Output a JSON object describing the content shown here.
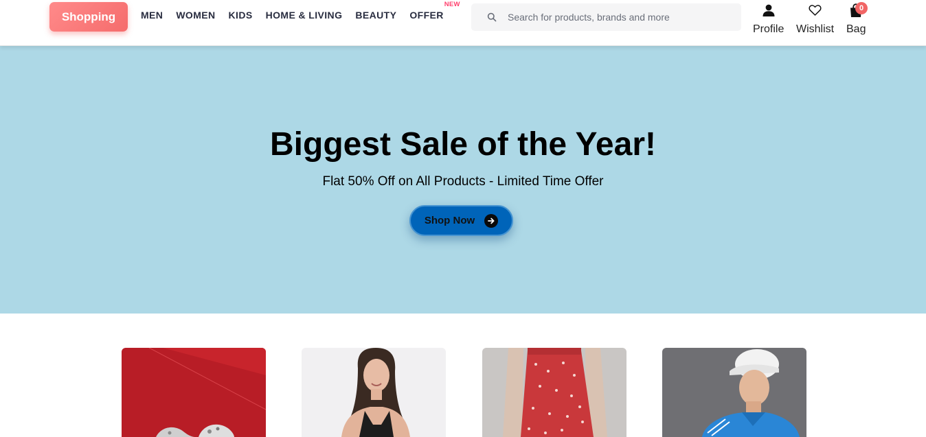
{
  "header": {
    "logo_label": "Shopping",
    "nav": [
      {
        "label": "MEN"
      },
      {
        "label": "WOMEN"
      },
      {
        "label": "KIDS"
      },
      {
        "label": "HOME & LIVING"
      },
      {
        "label": "BEAUTY"
      },
      {
        "label": "OFFER",
        "tag": "NEW"
      }
    ],
    "search": {
      "placeholder": "Search for products, brands and more",
      "value": ""
    },
    "actions": {
      "profile_label": "Profile",
      "wishlist_label": "Wishlist",
      "bag_label": "Bag",
      "bag_count": "0"
    }
  },
  "hero": {
    "title": "Biggest Sale of the Year!",
    "subtitle": "Flat 50% Off on All Products - Limited Time Offer",
    "cta_label": "Shop Now",
    "background_color": "#add8e6"
  },
  "products": [
    {
      "name": "product-card-jewelry"
    },
    {
      "name": "product-card-womens-top"
    },
    {
      "name": "product-card-floral-skirt"
    },
    {
      "name": "product-card-mens-polo"
    }
  ],
  "colors": {
    "logo": "#f56c6c",
    "nav_text": "#282c3f",
    "new_tag": "#ff3f6c",
    "bag_badge": "#f16565",
    "cta": "#0064b9"
  }
}
